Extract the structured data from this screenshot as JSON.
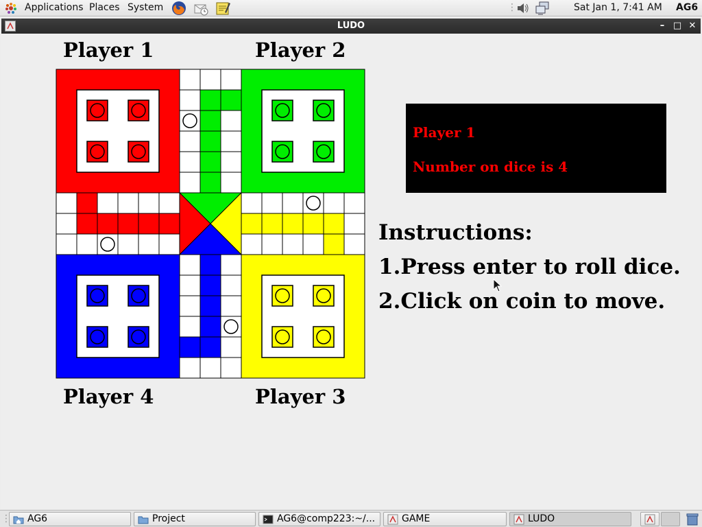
{
  "top_panel": {
    "menus": [
      "Applications",
      "Places",
      "System"
    ],
    "clock": "Sat Jan  1,  7:41 AM",
    "user": "AG6"
  },
  "window": {
    "title": "LUDO"
  },
  "game": {
    "players": [
      "Player 1",
      "Player 2",
      "Player 3",
      "Player 4"
    ],
    "dice_panel": {
      "current_player": "Player 1",
      "dice_text": "Number on dice is 4"
    },
    "instructions": {
      "title": "Instructions:",
      "lines": [
        "1.Press enter to roll dice.",
        "2.Click on coin to move."
      ]
    },
    "colors": {
      "red": "#ff0000",
      "green": "#00ee00",
      "blue": "#0000ff",
      "yellow": "#ffff00"
    }
  },
  "taskbar": {
    "items": [
      {
        "label": "AG6",
        "icon": "folder-home-icon"
      },
      {
        "label": "Project",
        "icon": "folder-icon"
      },
      {
        "label": "AG6@comp223:~/...",
        "icon": "terminal-icon"
      },
      {
        "label": "GAME",
        "icon": "java-app-icon"
      },
      {
        "label": "LUDO",
        "icon": "java-app-icon"
      }
    ]
  }
}
